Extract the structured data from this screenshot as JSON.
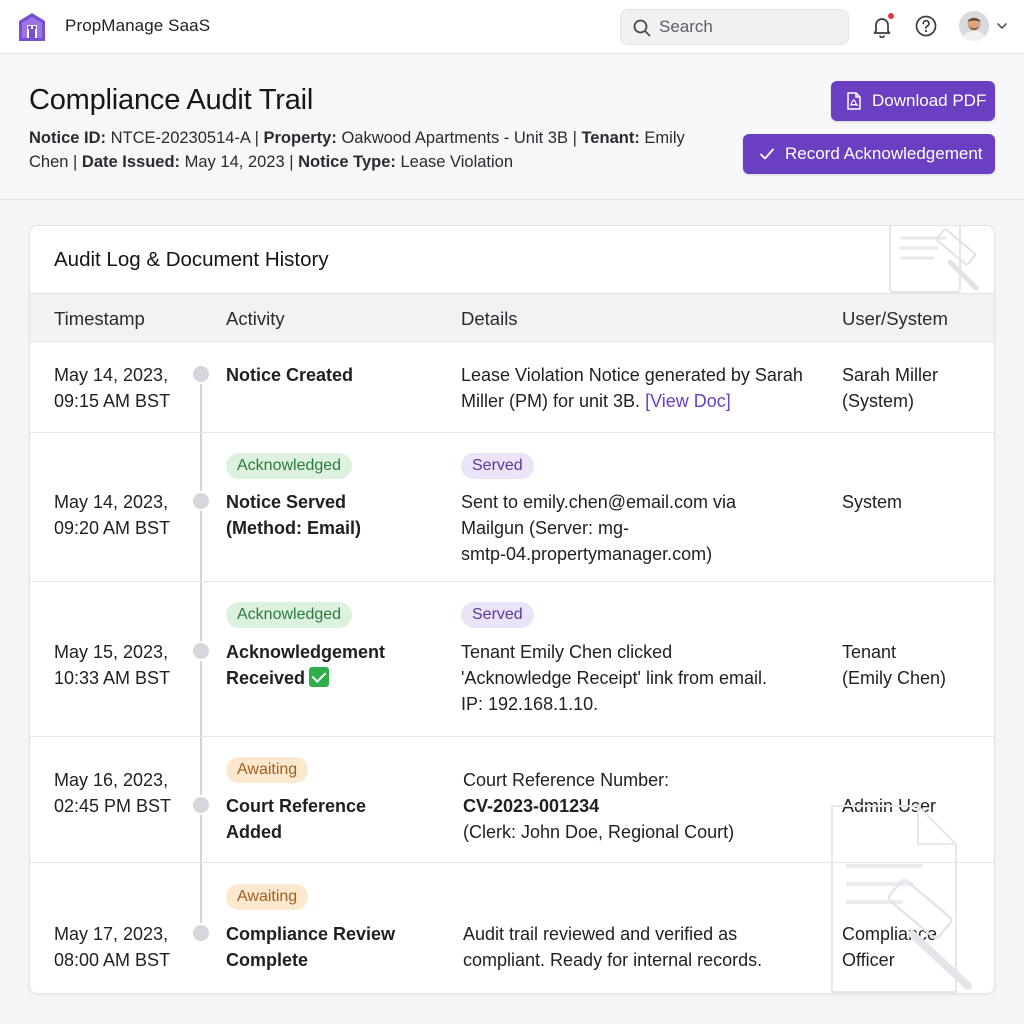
{
  "app": {
    "title": "PropManage SaaS"
  },
  "search": {
    "placeholder": "Search"
  },
  "colors": {
    "accent": "#6a3fc1",
    "acknowledged": "#2c7a3c",
    "served": "#5b3a9a",
    "awaiting": "#a0601a"
  },
  "header": {
    "title": "Compliance Audit Trail",
    "notice_id_label": "Notice ID:",
    "notice_id": "NTCE-20230514-A",
    "property_label": "Property:",
    "property": "Oakwood Apartments - Unit 3B",
    "tenant_label": "Tenant:",
    "tenant": "Emily Chen",
    "date_label": "Date Issued:",
    "date": "May 14, 2023",
    "type_label": "Notice Type:",
    "type": "Lease Violation",
    "download_label": "Download PDF",
    "record_label": "Record Acknowledgement"
  },
  "log": {
    "title": "Audit Log & Document History",
    "columns": [
      "Timestamp",
      "Activity",
      "Details",
      "User/System"
    ],
    "rows": [
      {
        "ts1": "May 14, 2023,",
        "ts2": "09:15 AM BST",
        "activity1": "Notice Created",
        "activity2": "",
        "details1": "Lease Violation Notice generated by Sarah",
        "details2": "Miller (PM) for unit 3B.",
        "link": "[View Doc]",
        "user1": "Sarah Miller",
        "user2": "(System)"
      },
      {
        "status": "Acknowledged",
        "tag": "Served",
        "ts1": "May 14, 2023,",
        "ts2": "09:20 AM BST",
        "activity1": "Notice Served",
        "activity2": "(Method: Email)",
        "details1": "Sent to emily.chen@email.com via",
        "details2": "Mailgun (Server: mg-",
        "details3": "smtp-04.propertymanager.com)",
        "user1": "System"
      },
      {
        "status": "Acknowledged",
        "tag": "Served",
        "ts1": "May 15, 2023,",
        "ts2": "10:33 AM BST",
        "activity1": "Acknowledgement",
        "activity2": "Received",
        "details1": "Tenant Emily Chen clicked",
        "details2": "'Acknowledge Receipt' link from email.",
        "details3": "IP: 192.168.1.10.",
        "user1": "Tenant",
        "user2": "(Emily Chen)"
      },
      {
        "status": "Awaiting",
        "ts1": "May 16, 2023,",
        "ts2": "02:45 PM BST",
        "activity1": "Court Reference",
        "activity2": "Added",
        "details1": "Court Reference Number:",
        "details2": "CV-2023-001234",
        "details3": "(Clerk: John Doe, Regional Court)",
        "user1": "Admin User"
      },
      {
        "status": "Awaiting",
        "ts1": "May 17, 2023,",
        "ts2": "08:00 AM BST",
        "activity1": "Compliance Review",
        "activity2": "Complete",
        "details1": "Audit trail reviewed and verified as",
        "details2": "compliant. Ready for internal records.",
        "user1": "Compliance",
        "user2": "Officer"
      }
    ]
  }
}
